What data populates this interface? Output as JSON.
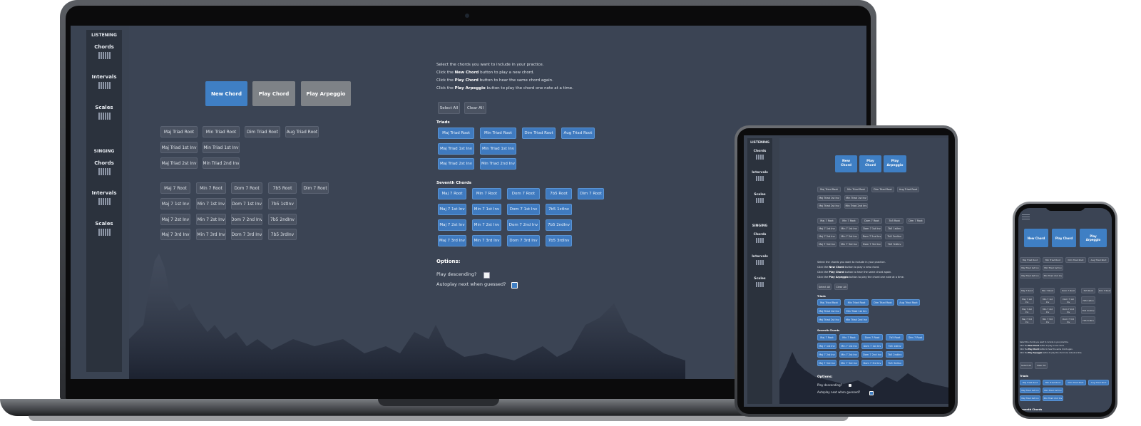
{
  "sidebar": {
    "listening_label": "LISTENING",
    "singing_label": "SINGING",
    "listening_items": [
      {
        "label": "Chords"
      },
      {
        "label": "Intervals"
      },
      {
        "label": "Scales"
      }
    ],
    "singing_items": [
      {
        "label": "Chords"
      },
      {
        "label": "Intervals"
      },
      {
        "label": "Scales"
      }
    ]
  },
  "controls": {
    "new_chord": "New Chord",
    "play_chord": "Play Chord",
    "play_arpeggio": "Play Arpeggio",
    "new_chord_short1": "New",
    "new_chord_short2": "Chord",
    "play_chord_short1": "Play",
    "play_chord_short2": "Chord",
    "play_arpeggio_short1": "Play",
    "play_arpeggio_short2": "Arpeggio"
  },
  "answers": {
    "triads": [
      "Maj Triad Root",
      "Min Triad Root",
      "Dim Triad Root",
      "Aug Triad Root",
      "Maj Triad 1st Inv",
      "Min Triad 1st Inv",
      "Maj Triad 2st Inv",
      "Min Triad 2nd Inv"
    ],
    "sevenths": [
      "Maj 7 Root",
      "Min 7 Root",
      "Dom 7 Root",
      "7b5 Root",
      "Dim 7 Root",
      "Maj 7 1st Inv",
      "Min 7 1st Inv",
      "Dom 7 1st Inv",
      "7b5 1stInv",
      "Maj 7 2st Inv",
      "Min 7 2st Inv",
      "Dom 7 2nd Inv",
      "7b5 2ndInv",
      "Maj 7 3rd Inv",
      "Min 7 3rd Inv",
      "Dom 7 3rd Inv",
      "7b5 3rdInv"
    ]
  },
  "instructions": {
    "line1": "Select the chords you want to include in your practice.",
    "line2_pre": "Click the ",
    "line2_bold": "New Chord",
    "line2_post": " button to play a new chord.",
    "line3_pre": "Click the ",
    "line3_bold": "Play Chord",
    "line3_post": " button to hear the same chord again.",
    "line4_pre": "Click the ",
    "line4_bold": "Play Arpeggio",
    "line4_post": " button to play the chord one note at a time."
  },
  "selection": {
    "select_all": "Select All",
    "clear_all": "Clear All",
    "triads_heading": "Triads",
    "sevenths_heading": "Seventh Chords",
    "triads": [
      "Maj Triad Root",
      "Min Triad Root",
      "Dim Triad Root",
      "Aug Triad Root",
      "Maj Triad 1st Inv",
      "Min Triad 1st Inv",
      "Maj Triad 2st Inv",
      "Min Triad 2nd Inv"
    ],
    "sevenths": [
      "Maj 7 Root",
      "Min 7 Root",
      "Dom 7 Root",
      "7b5 Root",
      "Dim 7 Root",
      "Maj 7 1st Inv",
      "Min 7 1st Inv",
      "Dom 7 1st Inv",
      "7b5 1stInv",
      "Maj 7 2st Inv",
      "Min 7 2st Inv",
      "Dom 7 2nd Inv",
      "7b5 2ndInv",
      "Maj 7 3rd Inv",
      "Min 7 3rd Inv",
      "Dom 7 3rd Inv",
      "7b5 3rdInv"
    ]
  },
  "options": {
    "heading": "Options:",
    "play_descending": "Play descending?",
    "play_descending_checked": false,
    "autoplay": "Autoplay next when guessed?",
    "autoplay_checked": true
  },
  "colors": {
    "accent_blue": "#3f7fc4",
    "panel_gray": "#4a5261",
    "background": "#3b4454",
    "sidebar": "#2b323d"
  },
  "icons": {
    "piano_keys": "piano-keys-icon",
    "crowd": "concert-crowd-illustration",
    "menu": "hamburger-menu-icon"
  }
}
